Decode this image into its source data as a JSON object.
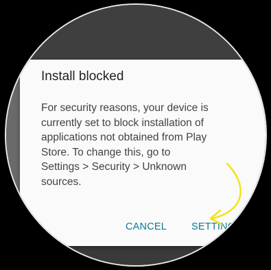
{
  "dialog": {
    "title": "Install blocked",
    "body_lines": [
      "For security reasons, your device is",
      "currently set to block installation of",
      "applications not obtained from Play",
      "Store. To change this, go to",
      "Settings > Security > Unknown",
      "sources."
    ],
    "cancel_label": "CANCEL",
    "settings_label": "SETTINGS"
  },
  "colors": {
    "accent": "#0b7a94",
    "annotation_arrow": "#f2e21a",
    "background": "#000000"
  },
  "icons": {
    "annotation": "curved-arrow-icon"
  }
}
